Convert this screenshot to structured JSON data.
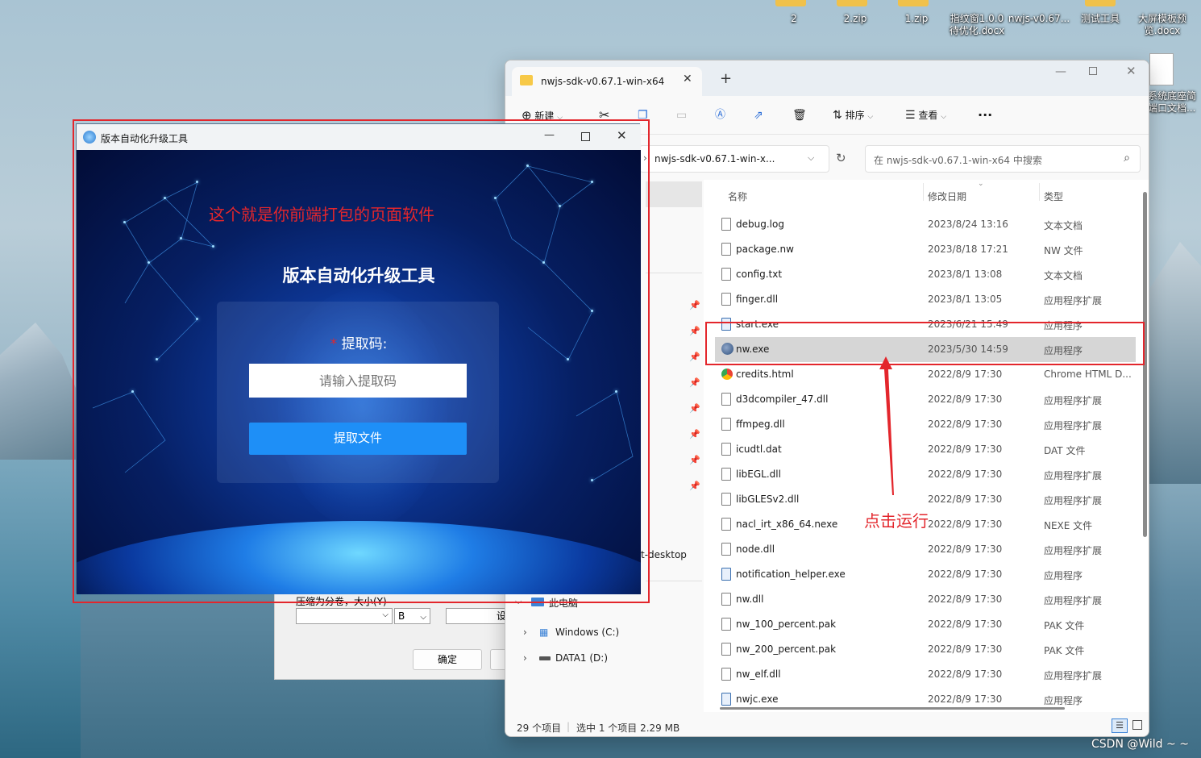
{
  "desktop": {
    "icons": [
      {
        "label": "2"
      },
      {
        "label": "2.zip"
      },
      {
        "label": "1.zip"
      },
      {
        "label": "指纹窗1.0.0\n待优化.docx"
      },
      {
        "label": "nwjs-v0.67..."
      },
      {
        "label": "测试工具"
      },
      {
        "label": "大屏模板预\n览.docx"
      }
    ],
    "right_doc_label": "系统底座简\n端口文档..."
  },
  "back_dialog": {
    "volume_label": "压缩为分卷，大小(Y)",
    "unit_value": "B",
    "ok_label": "确定",
    "partial_label": "设"
  },
  "explorer": {
    "tab_title": "nwjs-sdk-v0.67.1-win-x64",
    "new_tab": "+",
    "toolbar": {
      "new_label": "新建",
      "sort_label": "排序",
      "view_label": "查看",
      "more_label": "···"
    },
    "address": "nwjs-sdk-v0.67.1-win-x...",
    "search_placeholder": "在 nwjs-sdk-v0.67.1-win-x64 中搜索",
    "columns": {
      "name": "名称",
      "date": "修改日期",
      "type": "类型"
    },
    "files": [
      {
        "name": "debug.log",
        "date": "2023/8/24 13:16",
        "type": "文本文档",
        "icon": "file"
      },
      {
        "name": "package.nw",
        "date": "2023/8/18 17:21",
        "type": "NW 文件",
        "icon": "file"
      },
      {
        "name": "config.txt",
        "date": "2023/8/1 13:08",
        "type": "文本文档",
        "icon": "file"
      },
      {
        "name": "finger.dll",
        "date": "2023/8/1 13:05",
        "type": "应用程序扩展",
        "icon": "file"
      },
      {
        "name": "start.exe",
        "date": "2023/6/21 15:49",
        "type": "应用程序",
        "icon": "exe"
      },
      {
        "name": "nw.exe",
        "date": "2023/5/30 14:59",
        "type": "应用程序",
        "icon": "nw"
      },
      {
        "name": "credits.html",
        "date": "2022/8/9 17:30",
        "type": "Chrome HTML D...",
        "icon": "chrome"
      },
      {
        "name": "d3dcompiler_47.dll",
        "date": "2022/8/9 17:30",
        "type": "应用程序扩展",
        "icon": "file"
      },
      {
        "name": "ffmpeg.dll",
        "date": "2022/8/9 17:30",
        "type": "应用程序扩展",
        "icon": "file"
      },
      {
        "name": "icudtl.dat",
        "date": "2022/8/9 17:30",
        "type": "DAT 文件",
        "icon": "file"
      },
      {
        "name": "libEGL.dll",
        "date": "2022/8/9 17:30",
        "type": "应用程序扩展",
        "icon": "file"
      },
      {
        "name": "libGLESv2.dll",
        "date": "2022/8/9 17:30",
        "type": "应用程序扩展",
        "icon": "file"
      },
      {
        "name": "nacl_irt_x86_64.nexe",
        "date": "2022/8/9 17:30",
        "type": "NEXE 文件",
        "icon": "file"
      },
      {
        "name": "node.dll",
        "date": "2022/8/9 17:30",
        "type": "应用程序扩展",
        "icon": "file"
      },
      {
        "name": "notification_helper.exe",
        "date": "2022/8/9 17:30",
        "type": "应用程序",
        "icon": "exe"
      },
      {
        "name": "nw.dll",
        "date": "2022/8/9 17:30",
        "type": "应用程序扩展",
        "icon": "file"
      },
      {
        "name": "nw_100_percent.pak",
        "date": "2022/8/9 17:30",
        "type": "PAK 文件",
        "icon": "file"
      },
      {
        "name": "nw_200_percent.pak",
        "date": "2022/8/9 17:30",
        "type": "PAK 文件",
        "icon": "file"
      },
      {
        "name": "nw_elf.dll",
        "date": "2022/8/9 17:30",
        "type": "应用程序扩展",
        "icon": "file"
      },
      {
        "name": "nwjc.exe",
        "date": "2022/8/9 17:30",
        "type": "应用程序",
        "icon": "exe"
      }
    ],
    "nav": {
      "partial_item": "t-desktop",
      "this_pc": "此电脑",
      "drive_c": "Windows (C:)",
      "drive_d": "DATA1 (D:)"
    },
    "status": {
      "count": "29 个项目",
      "selected": "选中 1 个项目  2.29 MB"
    }
  },
  "app": {
    "window_title": "版本自动化升级工具",
    "annotation": "这个就是你前端打包的页面软件",
    "heading": "版本自动化升级工具",
    "required_mark": "*",
    "field_label": "提取码:",
    "input_placeholder": "请输入提取码",
    "button_label": "提取文件"
  },
  "annotation_click": "点击运行",
  "watermark": "CSDN @Wild ~ ~",
  "colors": {
    "annotation_red": "#e3262c",
    "button_blue": "#1e8ff7",
    "selection": "#cce4f7"
  }
}
